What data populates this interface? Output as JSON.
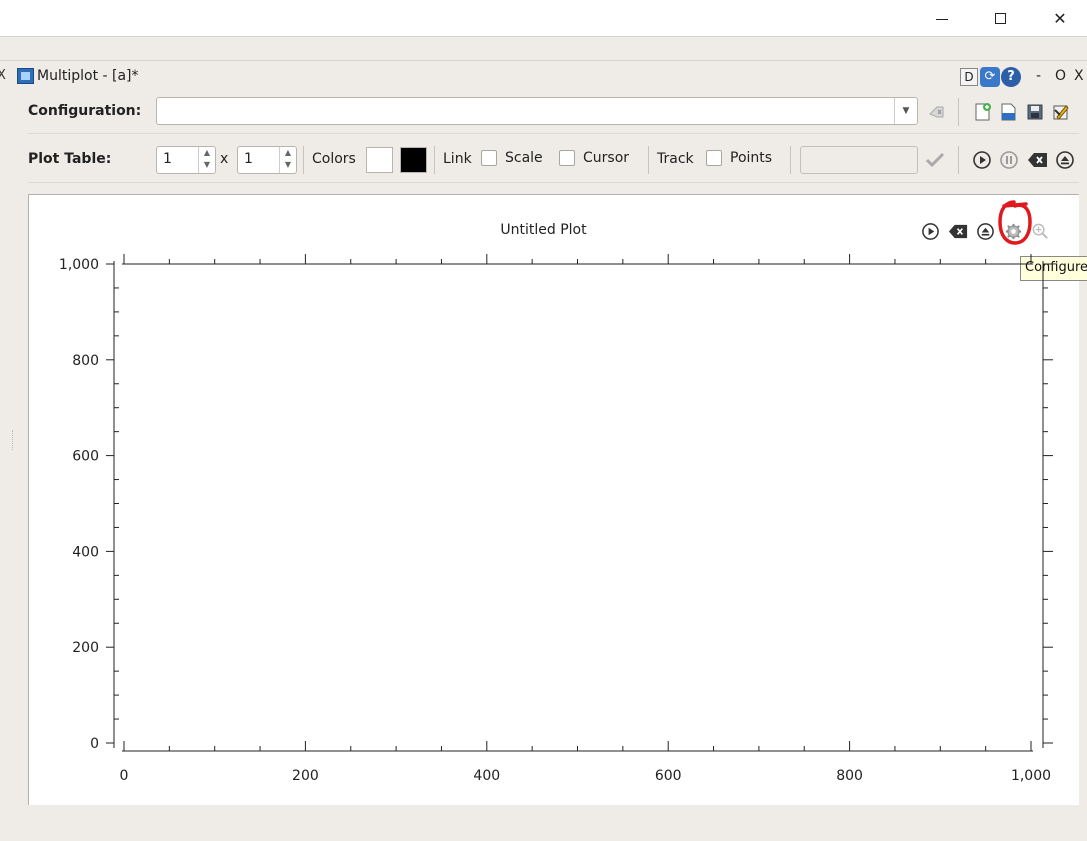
{
  "window": {
    "minimize": "–",
    "close": "✕"
  },
  "inner_window": {
    "close_glyph": "X",
    "title": "Multiplot - [a]*",
    "d_button": "D",
    "sync_glyph": "⟳",
    "help_glyph": "?",
    "minimize_glyph": "-",
    "maximize_glyph": "O",
    "close_right_glyph": "X"
  },
  "configuration": {
    "label": "Configuration:",
    "value": "",
    "icons": [
      "clear-config-icon",
      "new-config-icon",
      "open-config-icon",
      "save-config-icon",
      "edit-config-icon"
    ]
  },
  "plot_table": {
    "label": "Plot Table:",
    "rows": "1",
    "times": "x",
    "cols": "1",
    "colors_label": "Colors",
    "color_background": "#ffffff",
    "color_foreground": "#000000",
    "link_label": "Link",
    "scale_label": "Scale",
    "cursor_label": "Cursor",
    "track_label": "Track",
    "points_label": "Points",
    "track_value": ""
  },
  "plot": {
    "tooltip": "Configure",
    "tool_icons": [
      "play-icon",
      "clear-icon",
      "eject-icon",
      "gear-icon",
      "zoom-icon"
    ],
    "annotation_color": "#e0191e"
  },
  "chart_data": {
    "type": "line",
    "title": "Untitled Plot",
    "xlabel": "",
    "ylabel": "",
    "xlim": [
      0,
      1000
    ],
    "ylim": [
      0,
      1000
    ],
    "x_ticks": [
      "0",
      "200",
      "400",
      "600",
      "800",
      "1,000"
    ],
    "y_ticks": [
      "0",
      "200",
      "400",
      "600",
      "800",
      "1,000"
    ],
    "series": []
  }
}
